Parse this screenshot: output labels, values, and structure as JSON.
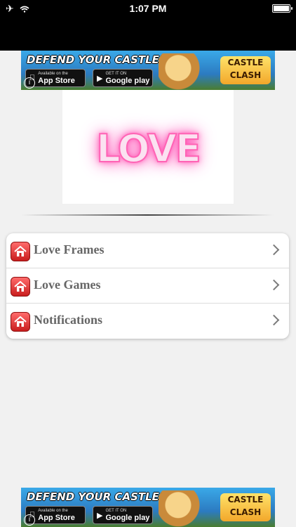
{
  "status_bar": {
    "time": "1:07 PM",
    "airplane_icon": "airplane-icon",
    "wifi_icon": "wifi-icon",
    "battery_icon": "battery-icon"
  },
  "ad_banner": {
    "headline": "DEFEND YOUR CASTLE!",
    "appstore_small": "Available on the",
    "appstore_label": "App Store",
    "google_small": "GET IT ON",
    "google_label": "Google play",
    "brand_line1": "CASTLE",
    "brand_line2": "CLASH",
    "info_icon": "i"
  },
  "logo": {
    "text": "LOVE",
    "glow_color": "#ff4fb0"
  },
  "menu": {
    "items": [
      {
        "label": "Love Frames",
        "icon": "home-icon"
      },
      {
        "label": "Love Games",
        "icon": "home-icon"
      },
      {
        "label": "Notifications",
        "icon": "home-icon"
      }
    ]
  }
}
